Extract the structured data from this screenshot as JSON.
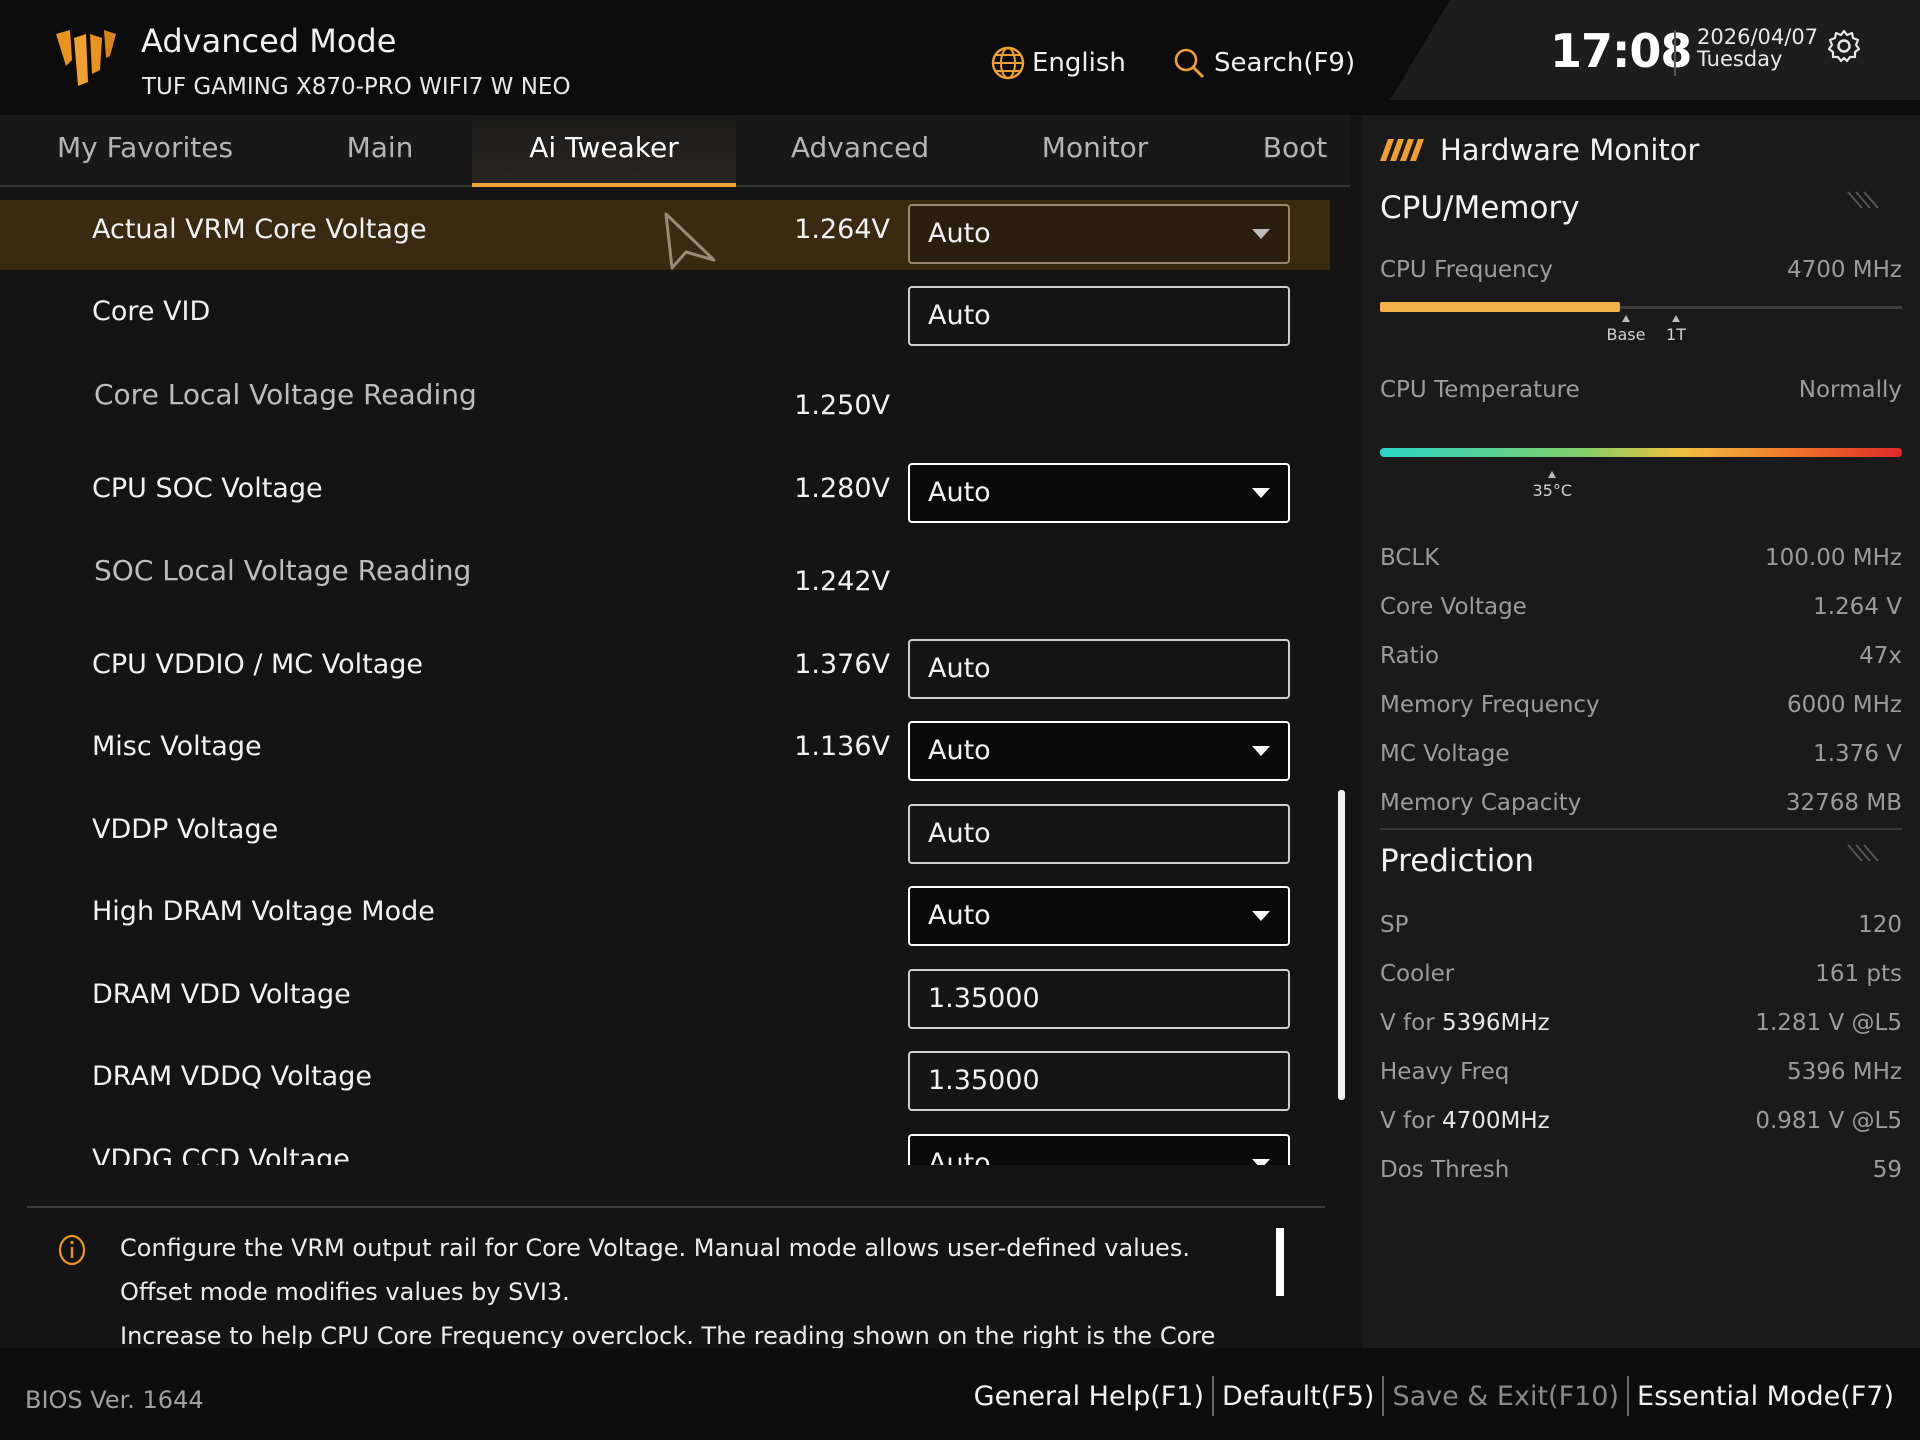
{
  "header": {
    "mode": "Advanced Mode",
    "board": "TUF GAMING X870-PRO WIFI7 W NEO",
    "language": "English",
    "search": "Search(F9)",
    "time": "17:08",
    "date": "2026/04/07",
    "weekday": "Tuesday",
    "icons": {
      "logo": "tuf-logo",
      "language": "globe-icon",
      "search": "search-icon",
      "settings": "gear-icon"
    }
  },
  "tabs": [
    {
      "label": "My Favorites",
      "active": false
    },
    {
      "label": "Main",
      "active": false
    },
    {
      "label": "Ai Tweaker",
      "active": true
    },
    {
      "label": "Advanced",
      "active": false
    },
    {
      "label": "Monitor",
      "active": false
    },
    {
      "label": "Boot",
      "active": false
    }
  ],
  "settings": [
    {
      "label": "Actual VRM Core Voltage",
      "value": "1.264V",
      "control": "Auto",
      "type": "dropdown",
      "highlight": true
    },
    {
      "label": "Core VID",
      "value": "",
      "control": "Auto",
      "type": "input"
    },
    {
      "label": "Core Local Voltage Reading",
      "value": "1.250V",
      "control": "",
      "type": "reading"
    },
    {
      "label": "CPU SOC Voltage",
      "value": "1.280V",
      "control": "Auto",
      "type": "dropdown"
    },
    {
      "label": "SOC Local Voltage Reading",
      "value": "1.242V",
      "control": "",
      "type": "reading"
    },
    {
      "label": "CPU VDDIO / MC Voltage",
      "value": "1.376V",
      "control": "Auto",
      "type": "input"
    },
    {
      "label": "Misc Voltage",
      "value": "1.136V",
      "control": "Auto",
      "type": "dropdown"
    },
    {
      "label": "VDDP Voltage",
      "value": "",
      "control": "Auto",
      "type": "input"
    },
    {
      "label": "High DRAM Voltage Mode",
      "value": "",
      "control": "Auto",
      "type": "dropdown"
    },
    {
      "label": "DRAM VDD Voltage",
      "value": "",
      "control": "1.35000",
      "type": "input"
    },
    {
      "label": "DRAM VDDQ Voltage",
      "value": "",
      "control": "1.35000",
      "type": "input"
    },
    {
      "label": "VDDG CCD Voltage",
      "value": "",
      "control": "Auto",
      "type": "dropdown"
    }
  ],
  "help": {
    "icon": "info-icon",
    "text": "Configure the VRM output rail for Core Voltage. Manual mode allows user-defined values. Offset mode modifies values by SVI3.",
    "text2": "Increase to help CPU Core Frequency overclock. The reading shown on the right is the Core Voltage"
  },
  "monitor": {
    "title": "Hardware Monitor",
    "cpu_section": "CPU/Memory",
    "cpu_frequency": {
      "label": "CPU Frequency",
      "value": "4700 MHz",
      "fill_percent": 46
    },
    "freq_ticks": [
      "Base",
      "1T"
    ],
    "cpu_temp": {
      "label": "CPU Temperature",
      "value": "Normally",
      "reading": "35°C",
      "marker_percent": 33
    },
    "stats": [
      {
        "label": "BCLK",
        "value": "100.00 MHz"
      },
      {
        "label": "Core Voltage",
        "value": "1.264 V"
      },
      {
        "label": "Ratio",
        "value": "47x"
      },
      {
        "label": "Memory Frequency",
        "value": "6000 MHz"
      },
      {
        "label": "MC Voltage",
        "value": "1.376 V"
      },
      {
        "label": "Memory Capacity",
        "value": "32768 MB"
      }
    ],
    "prediction_section": "Prediction",
    "prediction": [
      {
        "label": "SP",
        "bold": "",
        "value": "120"
      },
      {
        "label": "Cooler",
        "bold": "",
        "value": "161 pts"
      },
      {
        "label": "V for ",
        "bold": "5396MHz",
        "value": "1.281 V @L5"
      },
      {
        "label": "Heavy Freq",
        "bold": "",
        "value": "5396 MHz"
      },
      {
        "label": "V for ",
        "bold": "4700MHz",
        "value": "0.981 V @L5"
      },
      {
        "label": "Dos Thresh",
        "bold": "",
        "value": "59"
      }
    ]
  },
  "footer": {
    "bios_version": "BIOS Ver. 1644",
    "items": [
      {
        "label": "General Help(F1)",
        "dim": false
      },
      {
        "label": "Default(F5)",
        "dim": false
      },
      {
        "label": "Save & Exit(F10)",
        "dim": true
      },
      {
        "label": "Essential Mode(F7)",
        "dim": false
      }
    ]
  },
  "colors": {
    "accent": "#f0a030",
    "highlight_row": "#3a2a12",
    "freq_bar": "#f5b14a"
  }
}
